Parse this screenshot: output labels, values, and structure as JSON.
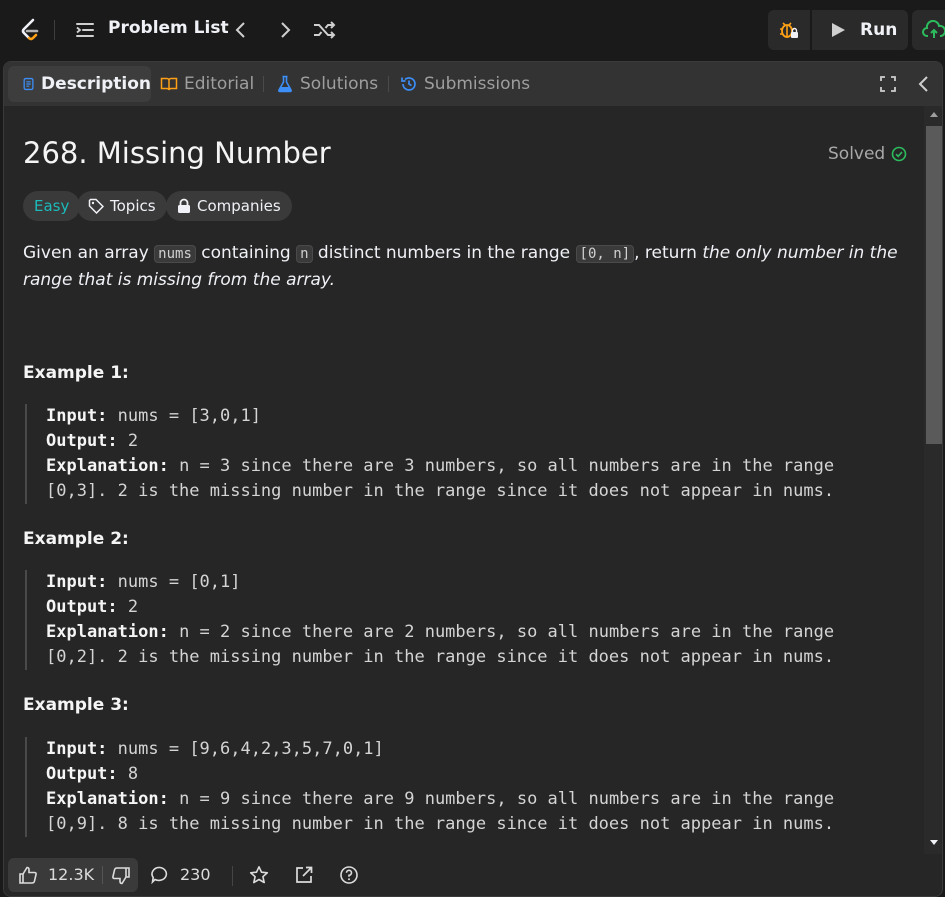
{
  "topbar": {
    "problem_list_label": "Problem List",
    "run_label": "Run"
  },
  "tabs": [
    {
      "label": "Description",
      "active": true
    },
    {
      "label": "Editorial",
      "active": false
    },
    {
      "label": "Solutions",
      "active": false
    },
    {
      "label": "Submissions",
      "active": false
    }
  ],
  "problem": {
    "title": "268. Missing Number",
    "status": "Solved",
    "difficulty": "Easy",
    "topics_label": "Topics",
    "companies_label": "Companies",
    "desc_part1": "Given an array ",
    "code_nums": "nums",
    "desc_part2": " containing ",
    "code_n": "n",
    "desc_part3": " distinct numbers in the range ",
    "code_range": "[0, n]",
    "desc_part4": ", return ",
    "desc_emph": "the only number in the range that is missing from the array."
  },
  "examples": [
    {
      "heading": "Example 1:",
      "input_label": "Input:",
      "input": "nums = [3,0,1]",
      "output_label": "Output:",
      "output": "2",
      "explanation_label": "Explanation:",
      "explanation_line1": "n = 3 since there are 3 numbers, so all numbers are in the range",
      "explanation_line2": "[0,3]. 2 is the missing number in the range since it does not appear in nums."
    },
    {
      "heading": "Example 2:",
      "input_label": "Input:",
      "input": "nums = [0,1]",
      "output_label": "Output:",
      "output": "2",
      "explanation_label": "Explanation:",
      "explanation_line1": "n = 2 since there are 2 numbers, so all numbers are in the range",
      "explanation_line2": "[0,2]. 2 is the missing number in the range since it does not appear in nums."
    },
    {
      "heading": "Example 3:",
      "input_label": "Input:",
      "input": "nums = [9,6,4,2,3,5,7,0,1]",
      "output_label": "Output:",
      "output": "8",
      "explanation_label": "Explanation:",
      "explanation_line1": "n = 9 since there are 9 numbers, so all numbers are in the range",
      "explanation_line2": "[0,9]. 8 is the missing number in the range since it does not appear in nums."
    }
  ],
  "footer": {
    "likes": "12.3K",
    "comments": "230"
  },
  "colors": {
    "accent_easy": "#1cbaba",
    "solved_green": "#2cbb5d",
    "submit_green": "#2cbb5d",
    "tab_description": "#3d8ef7",
    "tab_editorial": "#ffa116",
    "tab_solutions": "#3d8ef7"
  },
  "icons": {
    "logo": "leetcode-logo",
    "problem_list": "list-icon",
    "prev": "chevron-left-icon",
    "next": "chevron-right-icon",
    "shuffle": "shuffle-icon",
    "debug": "bug-icon",
    "run": "play-icon",
    "submit": "cloud-upload-icon"
  }
}
